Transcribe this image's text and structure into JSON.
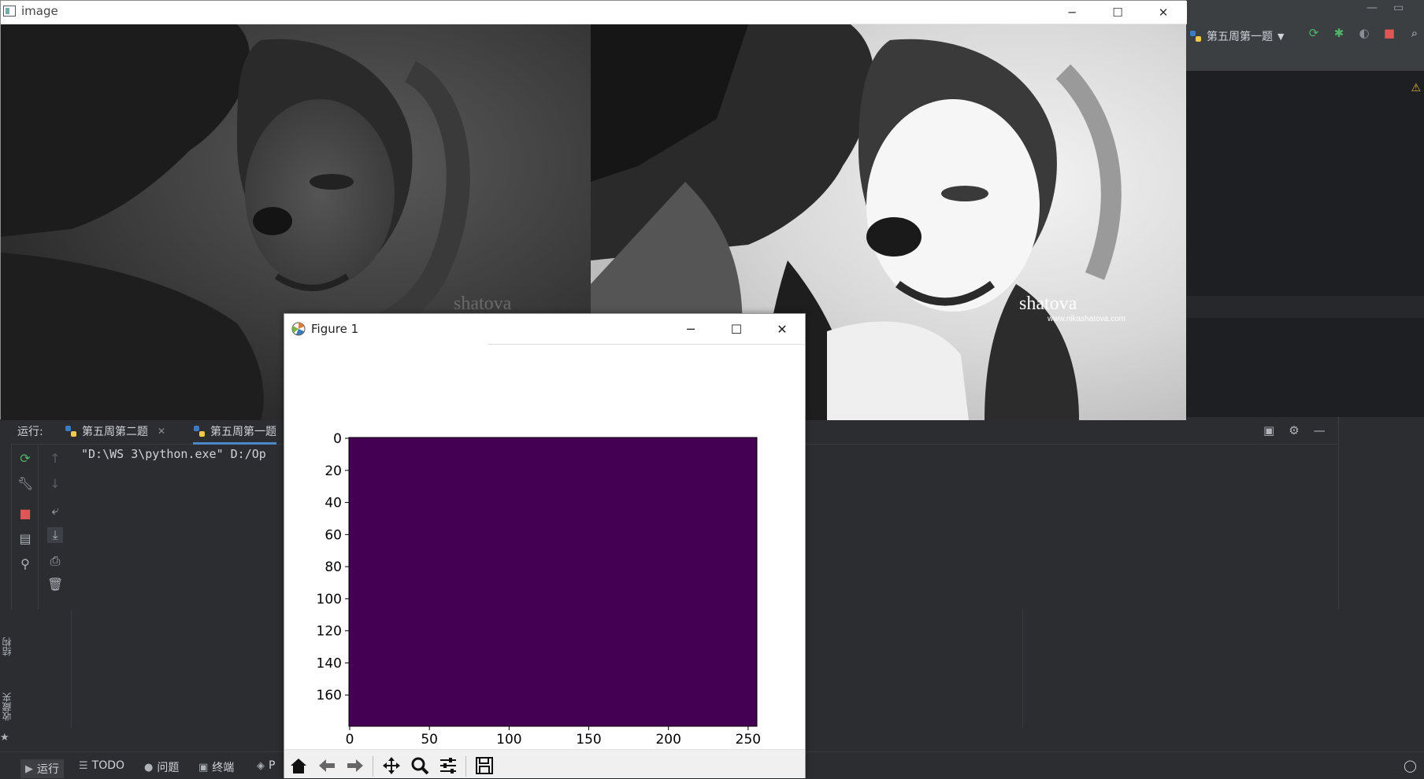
{
  "ide": {
    "run_config_label": "第五周第一题",
    "run_panel": {
      "label": "运行:",
      "tabs": [
        {
          "label": "第五周第二题",
          "closable": true
        },
        {
          "label": "第五周第一题",
          "closable": false
        }
      ],
      "console_line": "\"D:\\WS 3\\python.exe\" D:/Op"
    },
    "side_labels": [
      "结构",
      "收藏夹"
    ],
    "statusbar": {
      "items": [
        "运行",
        "TODO",
        "问题",
        "终端",
        "P"
      ]
    }
  },
  "image_window": {
    "title": "image",
    "watermark_left": "shatova",
    "watermark_right": "shatova",
    "watermark_right_url": "www.nikashatova.com"
  },
  "figure_window": {
    "title": "Figure 1",
    "toolbar": [
      "home-icon",
      "back-arrow-icon",
      "forward-arrow-icon",
      "pan-icon",
      "zoom-icon",
      "configure-subplots-icon",
      "save-icon"
    ]
  },
  "chart_data": {
    "type": "heatmap",
    "title": "",
    "xlabel": "",
    "ylabel": "",
    "x_ticks": [
      0,
      50,
      100,
      150,
      200,
      250
    ],
    "y_ticks": [
      0,
      20,
      40,
      60,
      80,
      100,
      120,
      140,
      160
    ],
    "xlim": [
      -0.5,
      255.5
    ],
    "ylim": [
      179.5,
      -0.5
    ],
    "fill_color": "#440154",
    "values": "uniform"
  },
  "colors": {
    "ide_bg": "#2b2d30",
    "heatmap_fill": "#440154",
    "accent_tab": "#4a88c7"
  }
}
